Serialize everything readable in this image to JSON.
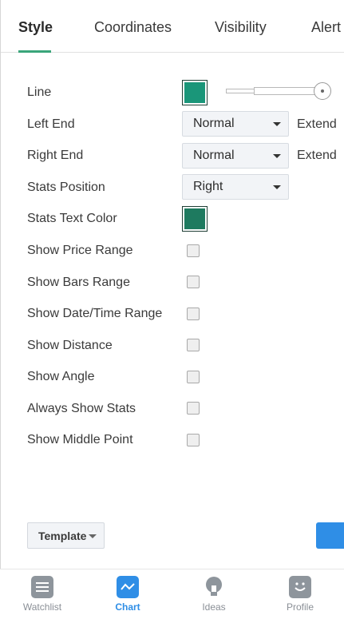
{
  "tabs": [
    {
      "label": "Style",
      "active": true
    },
    {
      "label": "Coordinates",
      "active": false
    },
    {
      "label": "Visibility",
      "active": false
    },
    {
      "label": "Alert",
      "active": false
    }
  ],
  "style": {
    "line_label": "Line",
    "line_color": "#1a9679",
    "left_end_label": "Left End",
    "left_end_value": "Normal",
    "right_end_label": "Right End",
    "right_end_value": "Normal",
    "extend_label": "Extend",
    "stats_position_label": "Stats Position",
    "stats_position_value": "Right",
    "stats_text_color_label": "Stats Text Color",
    "stats_text_color": "#1e7a5f",
    "checkboxes": [
      {
        "label": "Show Price Range",
        "checked": false
      },
      {
        "label": "Show Bars Range",
        "checked": false
      },
      {
        "label": "Show Date/Time Range",
        "checked": false
      },
      {
        "label": "Show Distance",
        "checked": false
      },
      {
        "label": "Show Angle",
        "checked": false
      },
      {
        "label": "Always Show Stats",
        "checked": false
      },
      {
        "label": "Show Middle Point",
        "checked": false
      }
    ]
  },
  "footer": {
    "template_label": "Template",
    "accent_color": "#2f8ee6"
  },
  "bottom_nav": [
    {
      "label": "Watchlist",
      "icon": "list-icon",
      "active": false
    },
    {
      "label": "Chart",
      "icon": "chart-icon",
      "active": true
    },
    {
      "label": "Ideas",
      "icon": "lightbulb-icon",
      "active": false
    },
    {
      "label": "Profile",
      "icon": "smiley-icon",
      "active": false
    }
  ]
}
